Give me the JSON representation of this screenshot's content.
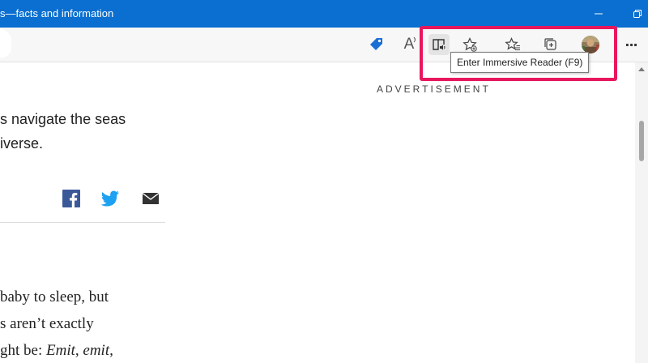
{
  "window": {
    "title": "s—facts and information"
  },
  "toolbar": {
    "read_aloud_glyph": "A",
    "more_glyph": "···",
    "tooltip": "Enter Immersive Reader (F9)"
  },
  "content": {
    "ad_label": "ADVERTISEMENT",
    "lead_lines": [
      "s navigate the seas",
      "iverse."
    ],
    "body_lines": {
      "line1": "baby to sleep, but",
      "line2": "s aren’t exactly",
      "line3_prefix": "ght be: ",
      "line3_emph": "Emit, emit,"
    }
  },
  "colors": {
    "titlebar": "#0a6fd0",
    "highlight": "#e8175d",
    "facebook": "#3b5998",
    "twitter": "#1da1f2",
    "tag": "#1a6fd6"
  }
}
